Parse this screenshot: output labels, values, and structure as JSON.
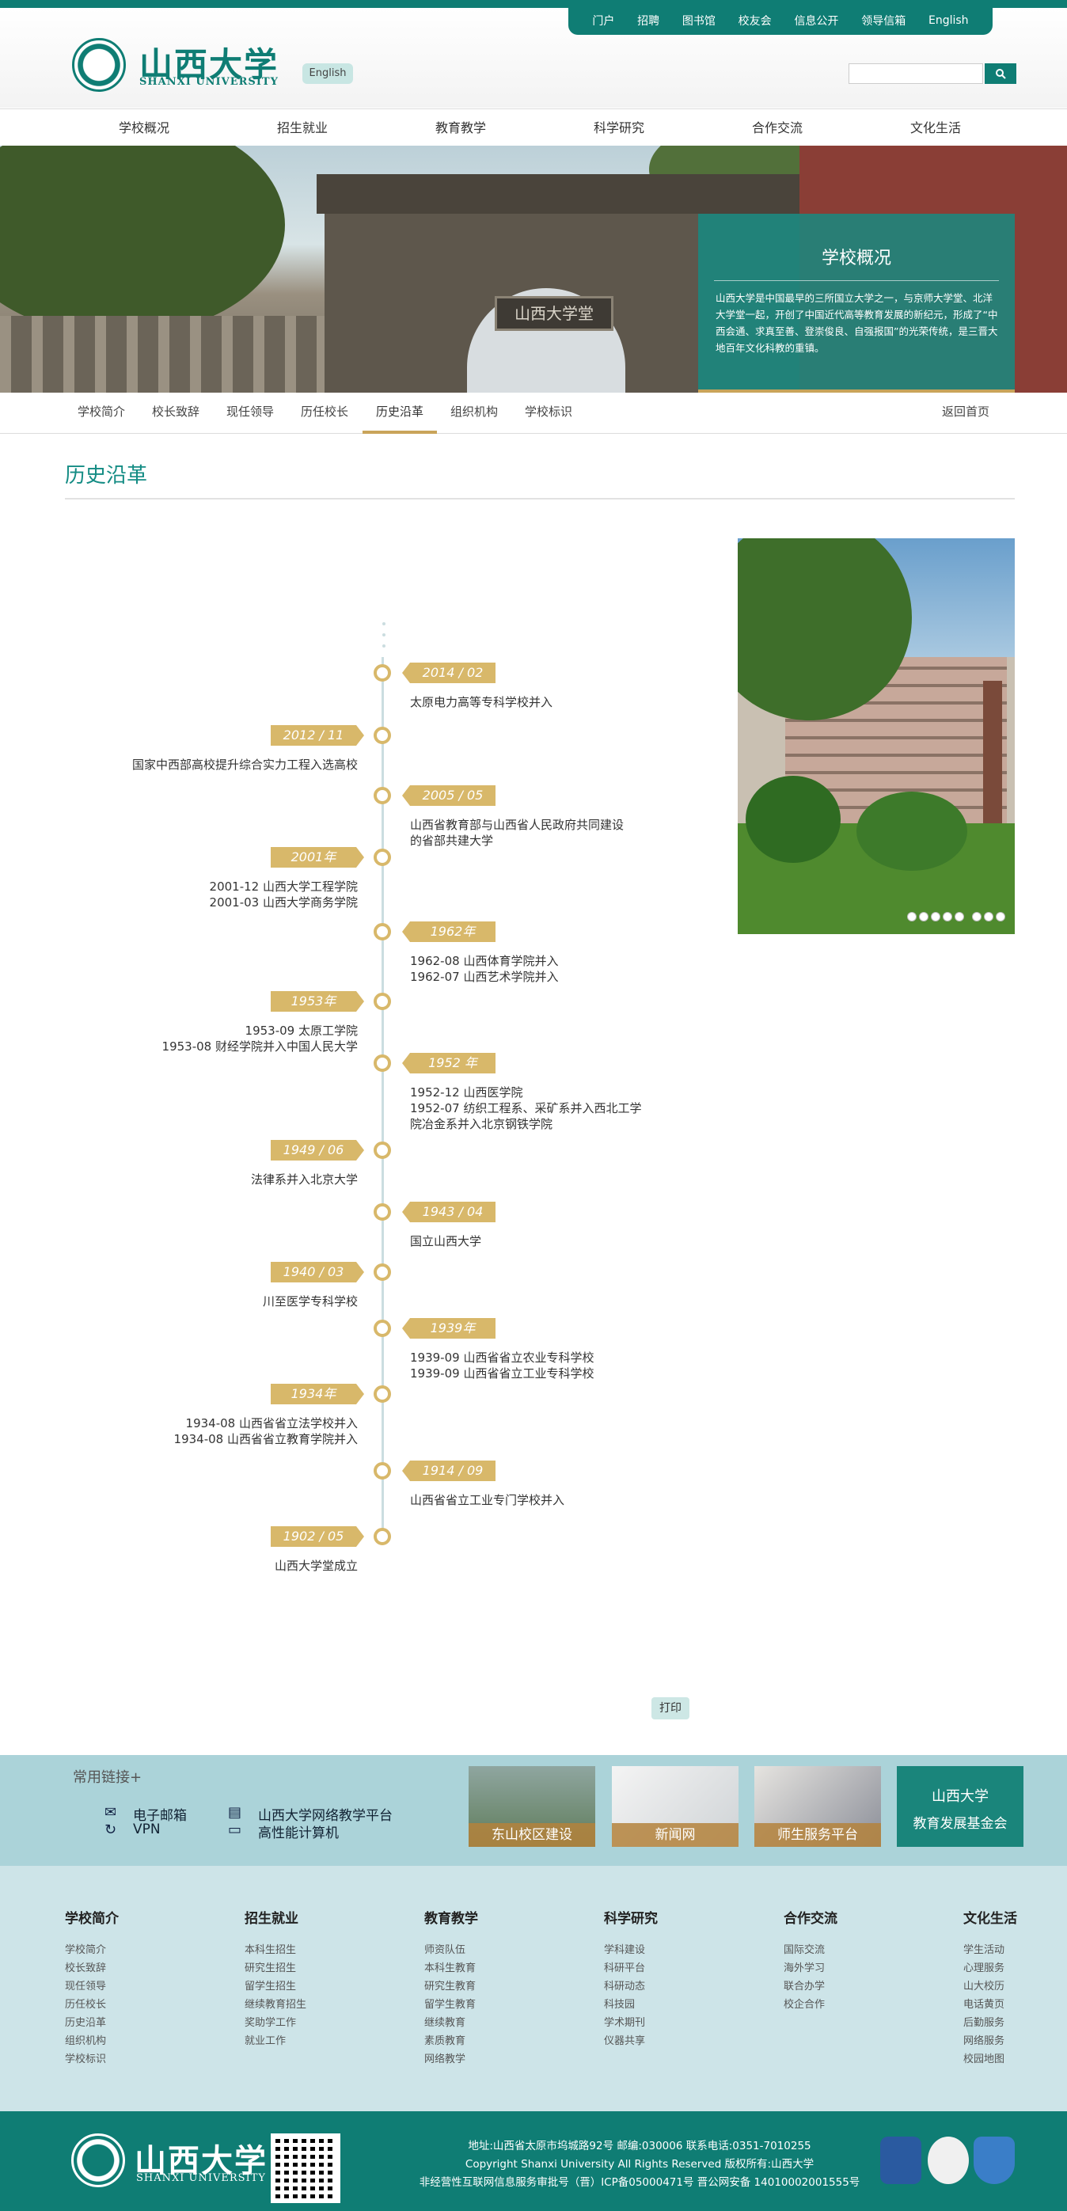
{
  "top_links": [
    "门户",
    "招聘",
    "图书馆",
    "校友会",
    "信息公开",
    "领导信箱",
    "English"
  ],
  "logo": {
    "cn": "山西大学",
    "en": "SHANXI UNIVERSITY"
  },
  "header": {
    "english_label": "English",
    "search_placeholder": ""
  },
  "main_nav": [
    "学校概况",
    "招生就业",
    "教育教学",
    "科学研究",
    "合作交流",
    "文化生活"
  ],
  "banner": {
    "plaque": "山西大学堂",
    "box_title": "学校概况",
    "box_text": "山西大学是中国最早的三所国立大学之一，与京师大学堂、北洋大学堂一起，开创了中国近代高等教育发展的新纪元，形成了“中西会通、求真至善、登崇俊良、自强报国”的光荣传统，是三晋大地百年文化科教的重镇。"
  },
  "sub_nav": {
    "items": [
      "学校简介",
      "校长致辞",
      "现任领导",
      "历任校长",
      "历史沿革",
      "组织机构",
      "学校标识"
    ],
    "active": "历史沿革",
    "back_home": "返回首页"
  },
  "section_title": "历史沿革",
  "timeline": [
    {
      "tag": "2014 / 02",
      "side": "right",
      "lines": [
        "太原电力高等专科学校并入"
      ]
    },
    {
      "tag": "2012 / 11",
      "side": "left",
      "lines": [
        "国家中西部高校提升综合实力工程入选高校"
      ]
    },
    {
      "tag": "2005 / 05",
      "side": "right",
      "lines": [
        "山西省教育部与山西省人民政府共同建设",
        "的省部共建大学"
      ]
    },
    {
      "tag": "2001年",
      "side": "left",
      "lines": [
        "2001-12 山西大学工程学院",
        "2001-03 山西大学商务学院"
      ]
    },
    {
      "tag": "1962年",
      "side": "right",
      "lines": [
        "1962-08 山西体育学院并入",
        "1962-07 山西艺术学院并入"
      ]
    },
    {
      "tag": "1953年",
      "side": "left",
      "lines": [
        "1953-09 太原工学院",
        "1953-08 财经学院并入中国人民大学"
      ]
    },
    {
      "tag": "1952 年",
      "side": "right",
      "lines": [
        "1952-12 山西医学院",
        "1952-07 纺织工程系、采矿系并入西北工学",
        "院冶金系并入北京钢铁学院"
      ]
    },
    {
      "tag": "1949 / 06",
      "side": "left",
      "lines": [
        "法律系并入北京大学"
      ]
    },
    {
      "tag": "1943 / 04",
      "side": "right",
      "lines": [
        "国立山西大学"
      ]
    },
    {
      "tag": "1940 / 03",
      "side": "left",
      "lines": [
        "川至医学专科学校"
      ]
    },
    {
      "tag": "1939年",
      "side": "right",
      "lines": [
        "1939-09 山西省省立农业专科学校",
        "1939-09 山西省省立工业专科学校"
      ]
    },
    {
      "tag": "1934年",
      "side": "left",
      "lines": [
        "1934-08  山西省省立法学校并入",
        "1934-08 山西省省立教育学院并入"
      ]
    },
    {
      "tag": "1914 / 09",
      "side": "right",
      "lines": [
        "山西省省立工业专门学校并入"
      ]
    },
    {
      "tag": "1902 / 05",
      "side": "left",
      "lines": [
        "山西大学堂成立"
      ]
    }
  ],
  "print_label": "打印",
  "links": {
    "title": "常用链接+",
    "items": [
      {
        "icon": "mail-icon",
        "label": "电子邮箱"
      },
      {
        "icon": "vpn-icon",
        "label": "VPN"
      },
      {
        "icon": "document-icon",
        "label": "山西大学网络教学平台"
      },
      {
        "icon": "monitor-icon",
        "label": "高性能计算机"
      }
    ],
    "tiles": [
      "东山校区建设",
      "新闻网",
      "师生服务平台"
    ],
    "foundation_tile": [
      "山西大学",
      "教育发展基金会"
    ]
  },
  "footer_nav": [
    {
      "title": "学校简介",
      "items": [
        "学校简介",
        "校长致辞",
        "现任领导",
        "历任校长",
        "历史沿革",
        "组织机构",
        "学校标识"
      ]
    },
    {
      "title": "招生就业",
      "items": [
        "本科生招生",
        "研究生招生",
        "留学生招生",
        "继续教育招生",
        "奖助学工作",
        "就业工作"
      ]
    },
    {
      "title": "教育教学",
      "items": [
        "师资队伍",
        "本科生教育",
        "研究生教育",
        "留学生教育",
        "继续教育",
        "素质教育",
        "网络教学"
      ]
    },
    {
      "title": "科学研究",
      "items": [
        "学科建设",
        "科研平台",
        "科研动态",
        "科技园",
        "学术期刊",
        "仪器共享"
      ]
    },
    {
      "title": "合作交流",
      "items": [
        "国际交流",
        "海外学习",
        "联合办学",
        "校企合作"
      ]
    },
    {
      "title": "文化生活",
      "items": [
        "学生活动",
        "心理服务",
        "山大校历",
        "电话黄页",
        "后勤服务",
        "网络服务",
        "校园地图"
      ]
    }
  ],
  "bottom": {
    "address": "地址:山西省太原市坞城路92号 邮编:030006 联系电话:0351-7010255",
    "copyright": "Copyright Shanxi University All Rights Reserved 版权所有:山西大学",
    "icp": "非经营性互联网信息服务审批号（晋）ICP备05000471号  晋公网安备 14010002001555号"
  },
  "colors": {
    "teal": "#0f7d74",
    "gold": "#d8b86a",
    "light_teal": "#abd3d9"
  }
}
